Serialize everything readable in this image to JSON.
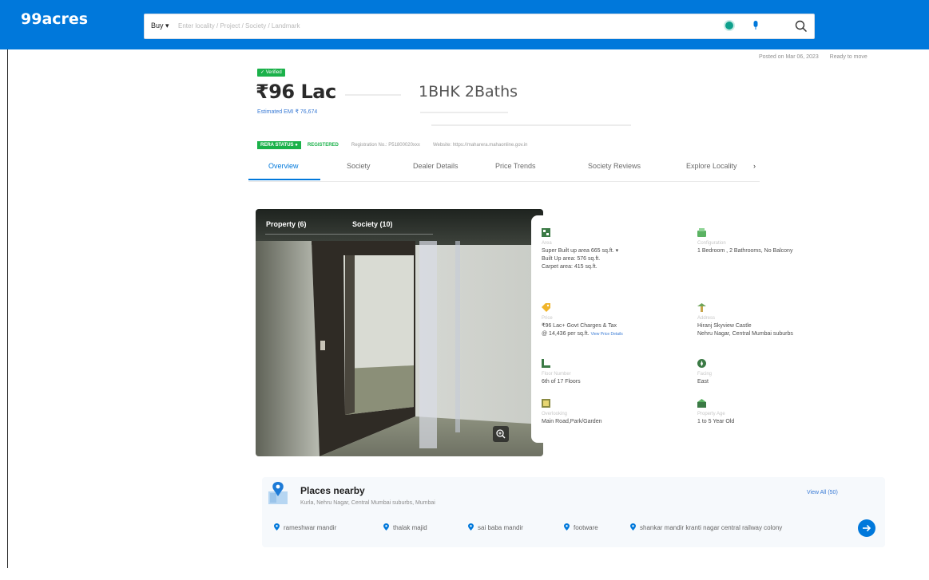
{
  "header": {
    "logo": "99acres",
    "search": {
      "buy_label": "Buy ▾",
      "placeholder": "Enter locality / Project / Society / Landmark"
    }
  },
  "posted": {
    "date": "Posted on Mar 06, 2023",
    "status": "Ready to move"
  },
  "listing": {
    "verified": "✓ Verified",
    "price": "₹96 Lac",
    "emi": "Estimated EMI ₹ 76,674",
    "config": "1BHK 2Baths"
  },
  "rera": {
    "status_label": "RERA STATUS ●",
    "status_value": "REGISTERED",
    "registration": "Registration No.: P51800020xxx",
    "website": "Website: https://maharera.mahaonline.gov.in"
  },
  "tabs": [
    "Overview",
    "Society",
    "Dealer Details",
    "Price Trends",
    "Society Reviews",
    "Explore Locality"
  ],
  "tabs_more": "›",
  "gallery": {
    "tab_property": "Property (6)",
    "tab_society": "Society (10)"
  },
  "details": {
    "area": {
      "label": "Area",
      "super": "Super Built up area 665 sq.ft. ▾",
      "builtup": "Built Up area: 576 sq.ft.",
      "carpet": "Carpet area: 415 sq.ft."
    },
    "configuration": {
      "label": "Configuration",
      "value": "1 Bedroom , 2 Bathrooms, No Balcony"
    },
    "price": {
      "label": "Price",
      "value": "₹96 Lac+ Govt Charges & Tax",
      "per_sqft": "@ 14,436 per sq.ft.",
      "more": "View Price Details"
    },
    "address": {
      "label": "Address",
      "value1": "Hiranj Skyview Castle",
      "value2": "Nehru Nagar, Central Mumbai suburbs"
    },
    "floor": {
      "label": "Floor Number",
      "value": "6th of 17 Floors"
    },
    "facing": {
      "label": "Facing",
      "value": "East"
    },
    "overlooking": {
      "label": "Overlooking",
      "value": "Main Road,Park/Garden"
    },
    "age": {
      "label": "Property Age",
      "value": "1 to 5 Year Old"
    }
  },
  "places": {
    "title": "Places nearby",
    "subtitle": "Kurla, Nehru Nagar, Central Mumbai suburbs, Mumbai",
    "view_all": "View All (50)",
    "chips": [
      "rameshwar mandir",
      "thalak majid",
      "sai baba mandir",
      "footware",
      "shankar mandir kranti nagar central railway colony"
    ]
  },
  "colors": {
    "brand": "#0078db",
    "green": "#1bb14a"
  }
}
